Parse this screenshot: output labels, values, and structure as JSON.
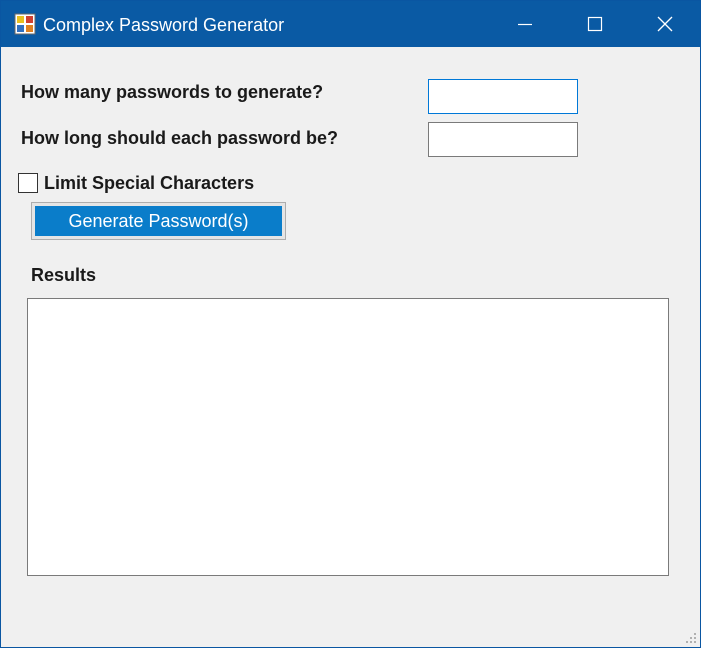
{
  "window": {
    "title": "Complex Password Generator",
    "icon": "app-icon",
    "controls": [
      "minimize-icon",
      "maximize-icon",
      "close-icon"
    ]
  },
  "form": {
    "count_label": "How many passwords to generate?",
    "count_value": "",
    "length_label": "How long should each password be?",
    "length_value": "",
    "limit_special_label": "Limit Special Characters",
    "limit_special_checked": false,
    "generate_button": "Generate Password(s)",
    "results_label": "Results",
    "results_value": ""
  },
  "colors": {
    "titlebar": "#0a5aa4",
    "window_bg": "#f0f0f0",
    "button_accent": "#0a7dca",
    "focus_border": "#0078d7"
  }
}
